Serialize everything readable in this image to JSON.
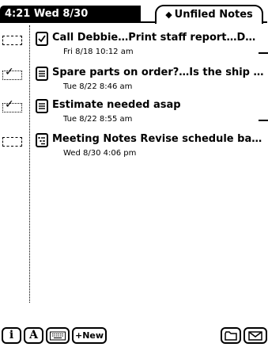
{
  "status_bar": {
    "clock": "4:21 Wed 8/30"
  },
  "folder_tab": {
    "label": "Unfiled Notes",
    "icon": "diamond-icon"
  },
  "notes": [
    {
      "title": "Call Debbie…Print staff report…D…",
      "date": "Fri 8/18 10:12 am",
      "checked": false,
      "type": "checklist"
    },
    {
      "title": "Spare parts on order?…Is the ship …",
      "date": "Tue 8/22 8:46 am",
      "checked": true,
      "type": "note"
    },
    {
      "title": "Estimate needed asap",
      "date": "Tue 8/22 8:55 am",
      "checked": true,
      "type": "note"
    },
    {
      "title": "Meeting Notes Revise schedule ba…",
      "date": "Wed 8/30 4:06 pm",
      "checked": false,
      "type": "outline"
    }
  ],
  "toolbar": {
    "info": "i",
    "abc": "A",
    "new": "New",
    "icons": [
      "info-icon",
      "abc-icon",
      "keyboard-icon",
      "new-icon",
      "folder-icon",
      "route-icon"
    ]
  }
}
